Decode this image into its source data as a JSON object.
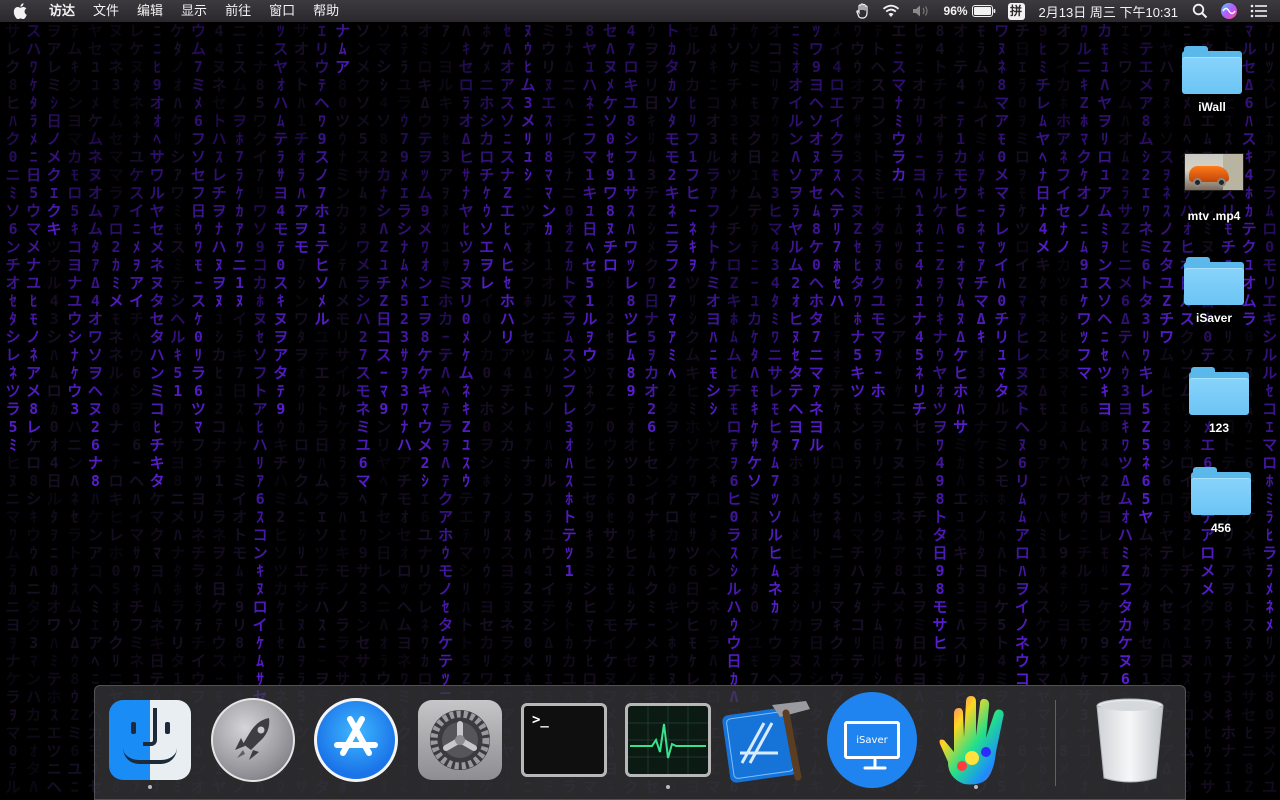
{
  "menubar": {
    "app_name": "访达",
    "menus": [
      "文件",
      "编辑",
      "显示",
      "前往",
      "窗口",
      "帮助"
    ],
    "battery_percent": "96%",
    "input_method": "拼",
    "clock": "2月13日 周三 下午10:31",
    "icons": [
      "apple-icon",
      "hand-icon",
      "wifi-icon",
      "volume-muted-icon",
      "battery-icon",
      "input-method-icon",
      "spotlight-icon",
      "siri-icon",
      "notification-center-icon"
    ]
  },
  "desktop": {
    "icons": [
      {
        "label": "iWall",
        "kind": "folder"
      },
      {
        "label": "mtv .mp4",
        "kind": "video"
      },
      {
        "label": "iSaver",
        "kind": "folder"
      },
      {
        "label": "123",
        "kind": "folder"
      },
      {
        "label": "456",
        "kind": "folder"
      }
    ]
  },
  "dock": {
    "apps": [
      {
        "name": "finder",
        "running": true
      },
      {
        "name": "launchpad",
        "running": false
      },
      {
        "name": "app-store",
        "running": false
      },
      {
        "name": "system-preferences",
        "running": false
      },
      {
        "name": "terminal",
        "running": false
      },
      {
        "name": "activity-monitor",
        "running": true
      },
      {
        "name": "xcode",
        "running": false
      },
      {
        "name": "isaver",
        "running": false
      },
      {
        "name": "iwall",
        "running": true
      },
      {
        "name": "trash",
        "running": false
      }
    ],
    "terminal_prompt": ">_",
    "isaver_text": "iSaver"
  },
  "colors": {
    "matrix_bright": "#5a1fd6",
    "matrix_dim": "#2a1a40",
    "folder": "#6cc4f4",
    "menubar": "#2f2d31"
  }
}
